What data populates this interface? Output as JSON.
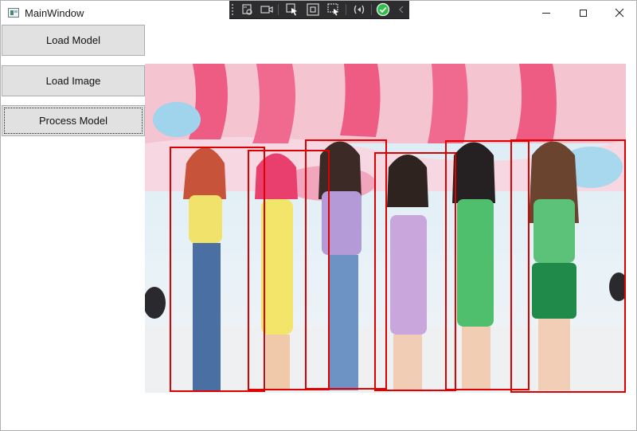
{
  "window": {
    "title": "MainWindow"
  },
  "debug_toolbar": {
    "icons": [
      "select-element-icon",
      "record-icon",
      "pointer-icon",
      "inspect-icon",
      "display-layout-icon",
      "hot-reload-icon",
      "check-icon",
      "collapse-icon"
    ]
  },
  "sidebar": {
    "buttons": [
      {
        "label": "Load Model"
      },
      {
        "label": "Load Image"
      },
      {
        "label": "Process Model"
      }
    ]
  },
  "detections": {
    "count": 6
  },
  "colors": {
    "box": "#e00000",
    "button_bg": "#e1e1e1",
    "toolbar_bg": "#2d2d30"
  }
}
